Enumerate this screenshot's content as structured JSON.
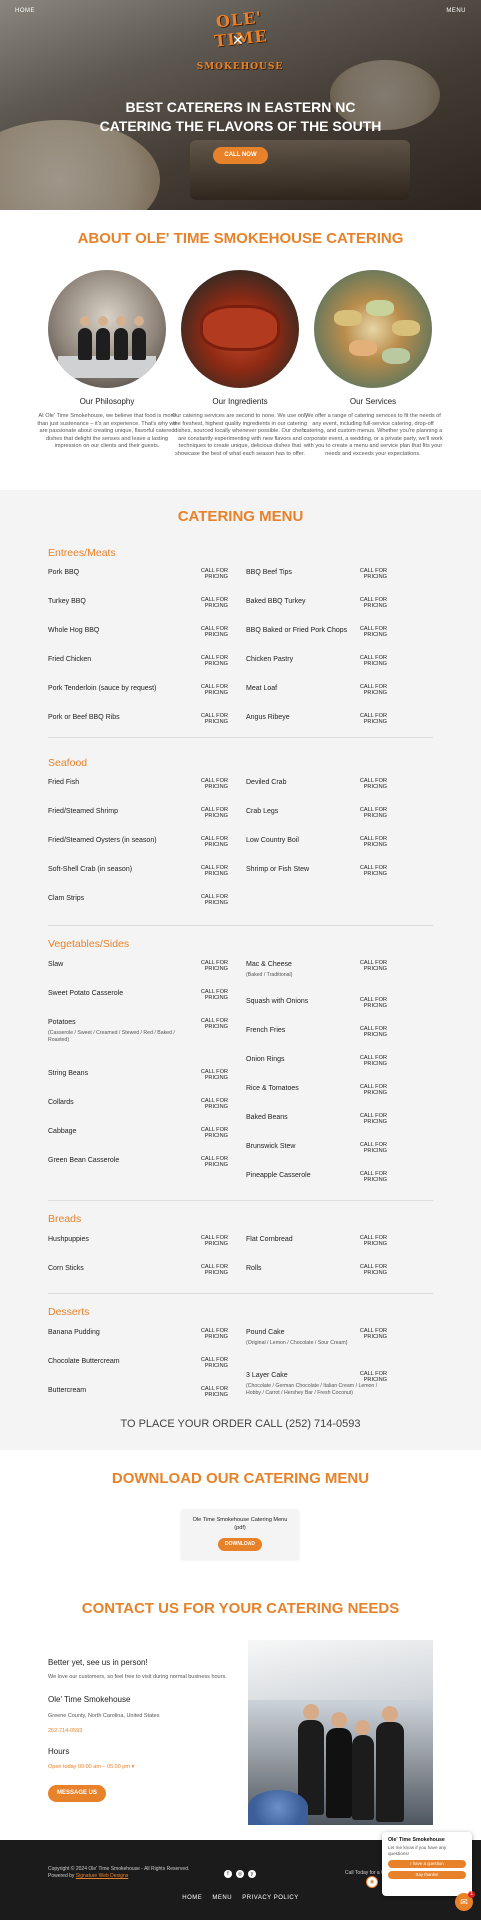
{
  "nav": {
    "home": "HOME",
    "menu": "MENU"
  },
  "logo": {
    "line1": "OLE' TIME",
    "line2": "SMOKEHOUSE"
  },
  "hero": {
    "line1": "BEST CATERERS IN EASTERN NC",
    "line2": "CATERING THE FLAVORS OF THE SOUTH",
    "cta": "CALL NOW"
  },
  "about": {
    "title": "ABOUT OLE' TIME SMOKEHOUSE CATERING",
    "cols": [
      {
        "heading": "Our Philosophy",
        "text": "At Ole' Time Smokehouse, we believe that food is more than just sustenance – it's an experience. That's why we are passionate about creating unique, flavorful catered dishes that delight the senses and leave a lasting impression on our clients and their guests."
      },
      {
        "heading": "Our Ingredients",
        "text": "Our catering services are second to none. We use only the freshest, highest quality ingredients in our catering dishes, sourced locally whenever possible. Our chefs are constantly experimenting with new flavors and techniques to create unique, delicious dishes that showcase the best of what each season has to offer."
      },
      {
        "heading": "Our Services",
        "text": "We offer a range of catering services to fit the needs of any event, including full-service catering, drop-off catering, and custom menus. Whether you're planning a corporate event, a wedding, or a private party, we'll work with you to create a menu and service plan that fits your needs and exceeds your expectations."
      }
    ]
  },
  "menu": {
    "title": "CATERING MENU",
    "price": "CALL FOR PRICING",
    "entrees": {
      "title": "Entrees/Meats",
      "left": [
        "Pork BBQ",
        "Turkey BBQ",
        "Whole Hog BBQ",
        "Fried Chicken",
        "Pork Tenderloin (sauce by request)",
        "Pork or Beef BBQ Ribs"
      ],
      "right": [
        "BBQ Beef Tips",
        "Baked BBQ Turkey",
        "BBQ Baked or Fried Pork Chops",
        "Chicken Pastry",
        "Meat Loaf",
        "Angus Ribeye"
      ]
    },
    "seafood": {
      "title": "Seafood",
      "left": [
        "Fried Fish",
        "Fried/Steamed Shrimp",
        "Fried/Steamed Oysters (in season)",
        "Soft-Shell Crab (in season)",
        "Clam Strips"
      ],
      "right": [
        "Deviled Crab",
        "Crab Legs",
        "Low Country Boil",
        "Shrimp or Fish Stew"
      ]
    },
    "veg": {
      "title": "Vegetables/Sides",
      "left": [
        {
          "name": "Slaw",
          "sub": ""
        },
        {
          "name": "Sweet Potato Casserole",
          "sub": ""
        },
        {
          "name": "Potatoes",
          "sub": "(Casserole / Sweet / Creamed / Stewed / Red / Baked / Roasted)"
        },
        {
          "name": "String Beans",
          "sub": ""
        },
        {
          "name": "Collards",
          "sub": ""
        },
        {
          "name": "Cabbage",
          "sub": ""
        },
        {
          "name": "Green Bean Casserole",
          "sub": ""
        }
      ],
      "right": [
        {
          "name": "Mac & Cheese",
          "sub": "(Baked / Traditional)"
        },
        {
          "name": "Squash with Onions",
          "sub": ""
        },
        {
          "name": "French Fries",
          "sub": ""
        },
        {
          "name": "Onion Rings",
          "sub": ""
        },
        {
          "name": "Rice & Tomatoes",
          "sub": ""
        },
        {
          "name": "Baked Beans",
          "sub": ""
        },
        {
          "name": "Brunswick Stew",
          "sub": ""
        },
        {
          "name": "Pineapple Casserole",
          "sub": ""
        }
      ]
    },
    "breads": {
      "title": "Breads",
      "left": [
        "Hushpuppies",
        "Corn Sticks"
      ],
      "right": [
        "Flat Cornbread",
        "Rolls"
      ]
    },
    "desserts": {
      "title": "Desserts",
      "left": [
        {
          "name": "Banana Pudding",
          "sub": ""
        },
        {
          "name": "Chocolate Buttercream",
          "sub": ""
        },
        {
          "name": "Buttercream",
          "sub": ""
        }
      ],
      "right": [
        {
          "name": "Pound Cake",
          "sub": "(Original / Lemon / Chocolate / Sour Cream)"
        },
        {
          "name": "3 Layer Cake",
          "sub": "(Chocolate / German Chocolate / Italian Cream / Lemon / Hobby / Carrot / Hershey Bar / Fresh Coconut)"
        }
      ]
    },
    "order": "TO PLACE YOUR ORDER CALL (252) 714-0593"
  },
  "download": {
    "title": "DOWNLOAD OUR CATERING MENU",
    "file": "Ole Time Smokehouse Catering Menu (pdf)",
    "button": "DOWNLOAD"
  },
  "contact": {
    "title": "CONTACT US FOR YOUR CATERING NEEDS",
    "subhead": "Better yet, see us in person!",
    "welcome": "We love our customers, so feel free to visit during normal business hours.",
    "name": "Ole' Time Smokehouse",
    "location": "Greene County, North Carolina, United States",
    "phone": "252-714-0593",
    "hours_label": "Hours",
    "hours": "Open today 09:00 am – 05:00 pm",
    "button": "MESSAGE US"
  },
  "footer": {
    "copyright": "Copyright © 2024 Ole' Time Smokehouse - All Rights Reserved.",
    "powered": "Powered by",
    "powered_link": "Signature Web Designs",
    "links": [
      "HOME",
      "MENU",
      "PRIVACY POLICY"
    ],
    "call": "Call Today for a Qu"
  },
  "chat": {
    "name": "Ole' Time Smokehouse",
    "message": "Let me know if you have any questions!",
    "btn1": "I have a question",
    "btn2": "Say thanks!",
    "badge": "1"
  },
  "colors": {
    "accent": "#e8822a",
    "footer": "#1b1b1b"
  }
}
